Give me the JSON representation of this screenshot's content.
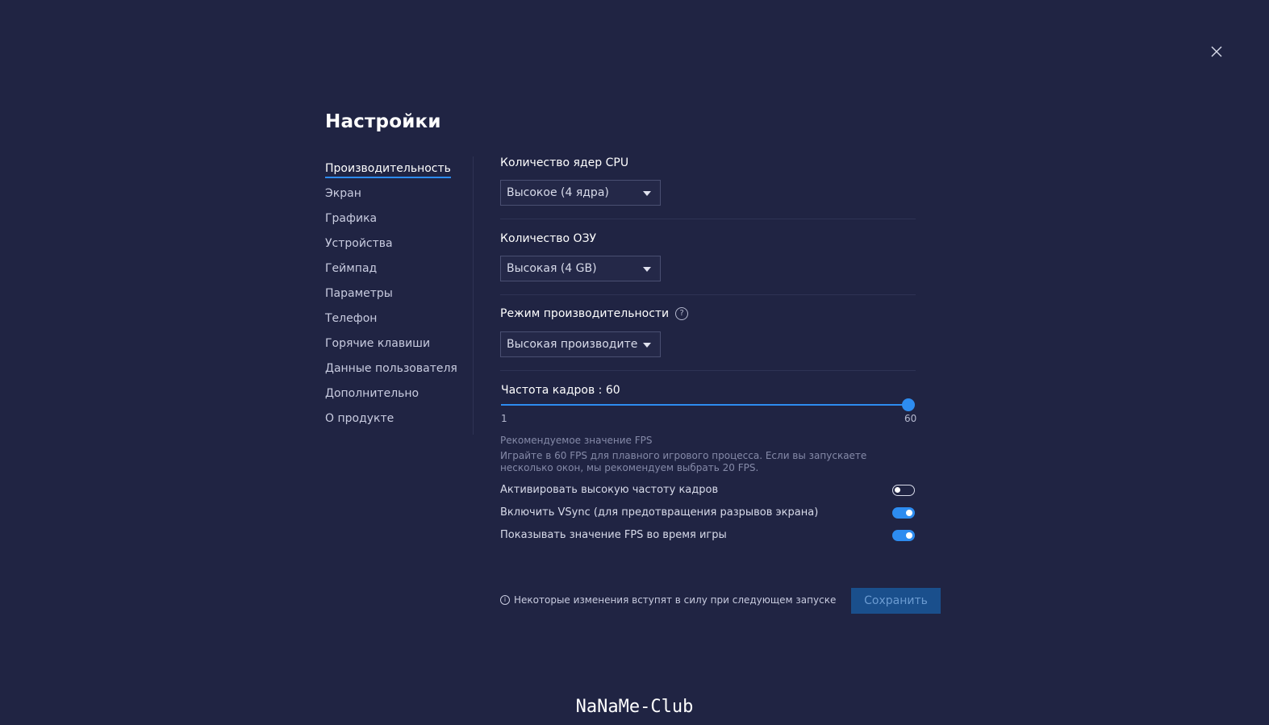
{
  "title": "Настройки",
  "close_icon": "close-icon",
  "sidebar": {
    "items": [
      {
        "label": "Производительность",
        "active": true
      },
      {
        "label": "Экран"
      },
      {
        "label": "Графика"
      },
      {
        "label": "Устройства"
      },
      {
        "label": "Геймпад"
      },
      {
        "label": "Параметры"
      },
      {
        "label": "Телефон"
      },
      {
        "label": "Горячие клавиши"
      },
      {
        "label": "Данные пользователя"
      },
      {
        "label": "Дополнительно"
      },
      {
        "label": "О продукте"
      }
    ]
  },
  "performance": {
    "cpu": {
      "label": "Количество ядер CPU",
      "value": "Высокое (4 ядра)"
    },
    "ram": {
      "label": "Количество ОЗУ",
      "value": "Высокая (4 GB)"
    },
    "mode": {
      "label": "Режим производительности",
      "help": "?",
      "value": "Высокая производительность"
    },
    "fps": {
      "label": "Частота кадров : 60",
      "value": 60,
      "min": "1",
      "max": "60",
      "hint_title": "Рекомендуемое значение FPS",
      "hint_text": "Играйте в 60 FPS для плавного игрового процесса. Если вы запускаете несколько окон, мы рекомендуем выбрать 20 FPS."
    },
    "toggles": [
      {
        "label": "Активировать высокую частоту кадров",
        "on": false
      },
      {
        "label": "Включить VSync (для предотвращения разрывов экрана)",
        "on": true
      },
      {
        "label": "Показывать значение FPS во время игры",
        "on": true
      }
    ]
  },
  "footer": {
    "info": "i",
    "note": "Некоторые изменения вступят в силу при следующем запуске",
    "save_label": "Сохранить"
  },
  "watermark": "NaNaMe-Club",
  "colors": {
    "background": "#202443",
    "accent": "#2d8cf0",
    "save_button": "#1a4f8c"
  }
}
